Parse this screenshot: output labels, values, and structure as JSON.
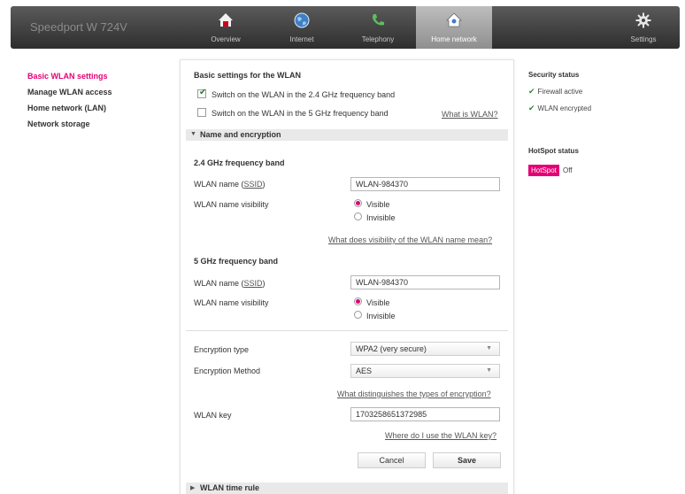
{
  "header": {
    "brand": "Speedport W 724V",
    "nav": [
      {
        "label": "Overview",
        "icon": "house-icon"
      },
      {
        "label": "Internet",
        "icon": "globe-icon"
      },
      {
        "label": "Telephony",
        "icon": "phone-icon"
      },
      {
        "label": "Home network",
        "icon": "home-network-icon",
        "active": true
      },
      {
        "label": "Settings",
        "icon": "gear-icon"
      }
    ]
  },
  "sidebar": {
    "items": [
      {
        "label": "Basic WLAN settings",
        "active": true
      },
      {
        "label": "Manage WLAN access"
      },
      {
        "label": "Home network (LAN)"
      },
      {
        "label": "Network storage"
      }
    ]
  },
  "main": {
    "title": "Basic settings for the WLAN",
    "switch_24": {
      "label": "Switch on the WLAN in the 2.4 GHz frequency band",
      "checked": true
    },
    "switch_5": {
      "label": "Switch on the WLAN in the 5 GHz frequency band",
      "checked": false
    },
    "what_is_wlan": "What is WLAN?",
    "name_section": "Name and encryption",
    "band24": {
      "heading": "2.4 GHz frequency band",
      "name_label": "WLAN name (",
      "ssid": "SSID",
      "name_label_end": ")",
      "ssid_value": "WLAN-984370",
      "visibility_label": "WLAN name visibility",
      "visible": "Visible",
      "invisible": "Invisible",
      "selected": "Visible"
    },
    "visibility_help": "What does visibility of the WLAN name mean?",
    "band5": {
      "heading": "5 GHz frequency band",
      "name_label": "WLAN name (",
      "ssid": "SSID",
      "name_label_end": ")",
      "ssid_value": "WLAN-984370",
      "visibility_label": "WLAN name visibility",
      "visible": "Visible",
      "invisible": "Invisible",
      "selected": "Visible"
    },
    "encryption_type_label": "Encryption type",
    "encryption_type_value": "WPA2 (very secure)",
    "encryption_method_label": "Encryption Method",
    "encryption_method_value": "AES",
    "encryption_help": "What distinguishes the types of encryption?",
    "key_label": "WLAN key",
    "key_value": "1703258651372985",
    "key_help": "Where do I use the WLAN key?",
    "cancel": "Cancel",
    "save": "Save",
    "time_rule_section": "WLAN time rule"
  },
  "right": {
    "security_title": "Security status",
    "firewall": "Firewall active",
    "wlan_encrypted": "WLAN encrypted",
    "hotspot_title": "HotSpot status",
    "hotspot_badge": "HotSpot",
    "hotspot_state": "Off"
  },
  "colors": {
    "accent": "#e20074",
    "ok": "#2d8a2d"
  }
}
